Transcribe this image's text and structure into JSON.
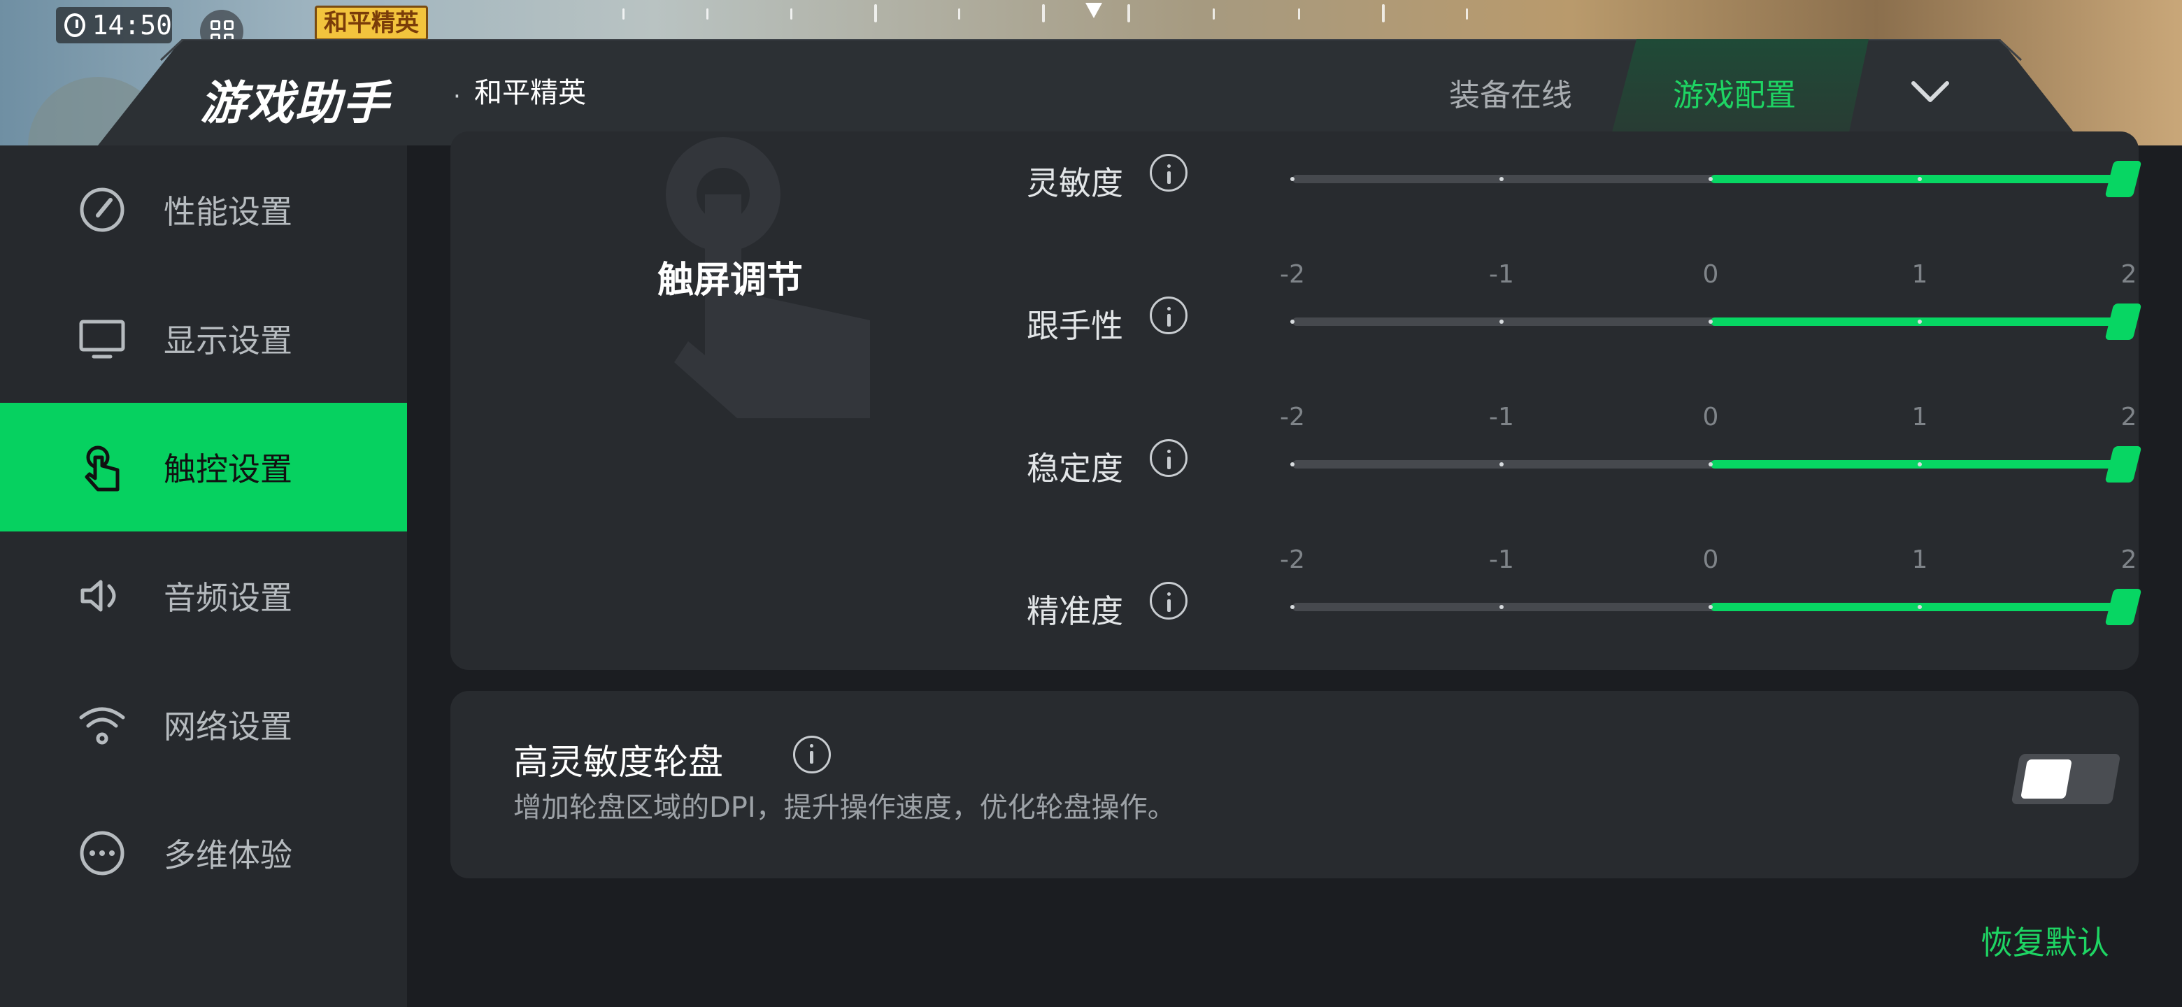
{
  "status": {
    "time": "14:50"
  },
  "game_badge": "和平精英",
  "header": {
    "title": "游戏助手",
    "separator": "·",
    "game": "和平精英",
    "tabs": [
      {
        "label": "装备在线",
        "active": false
      },
      {
        "label": "游戏配置",
        "active": true
      }
    ]
  },
  "sidebar": {
    "items": [
      {
        "label": "性能设置",
        "icon": "gauge-icon",
        "active": false
      },
      {
        "label": "显示设置",
        "icon": "monitor-icon",
        "active": false
      },
      {
        "label": "触控设置",
        "icon": "touch-icon",
        "active": true
      },
      {
        "label": "音频设置",
        "icon": "speaker-icon",
        "active": false
      },
      {
        "label": "网络设置",
        "icon": "wifi-icon",
        "active": false
      },
      {
        "label": "多维体验",
        "icon": "more-icon",
        "active": false
      }
    ]
  },
  "touch_panel": {
    "title": "触屏调节",
    "scale": [
      "-2",
      "-1",
      "0",
      "1",
      "2"
    ],
    "sliders": [
      {
        "label": "灵敏度",
        "value": 2
      },
      {
        "label": "跟手性",
        "value": 2
      },
      {
        "label": "稳定度",
        "value": 2
      },
      {
        "label": "精准度",
        "value": 2
      }
    ]
  },
  "dial": {
    "title": "高灵敏度轮盘",
    "description": "增加轮盘区域的DPI，提升操作速度，优化轮盘操作。",
    "enabled": false
  },
  "footer": {
    "restore_label": "恢复默认"
  },
  "colors": {
    "accent": "#07d663",
    "sidebar_bg": "#26292d",
    "card_bg": "#282b2f",
    "page_bg": "#1b1d21"
  }
}
